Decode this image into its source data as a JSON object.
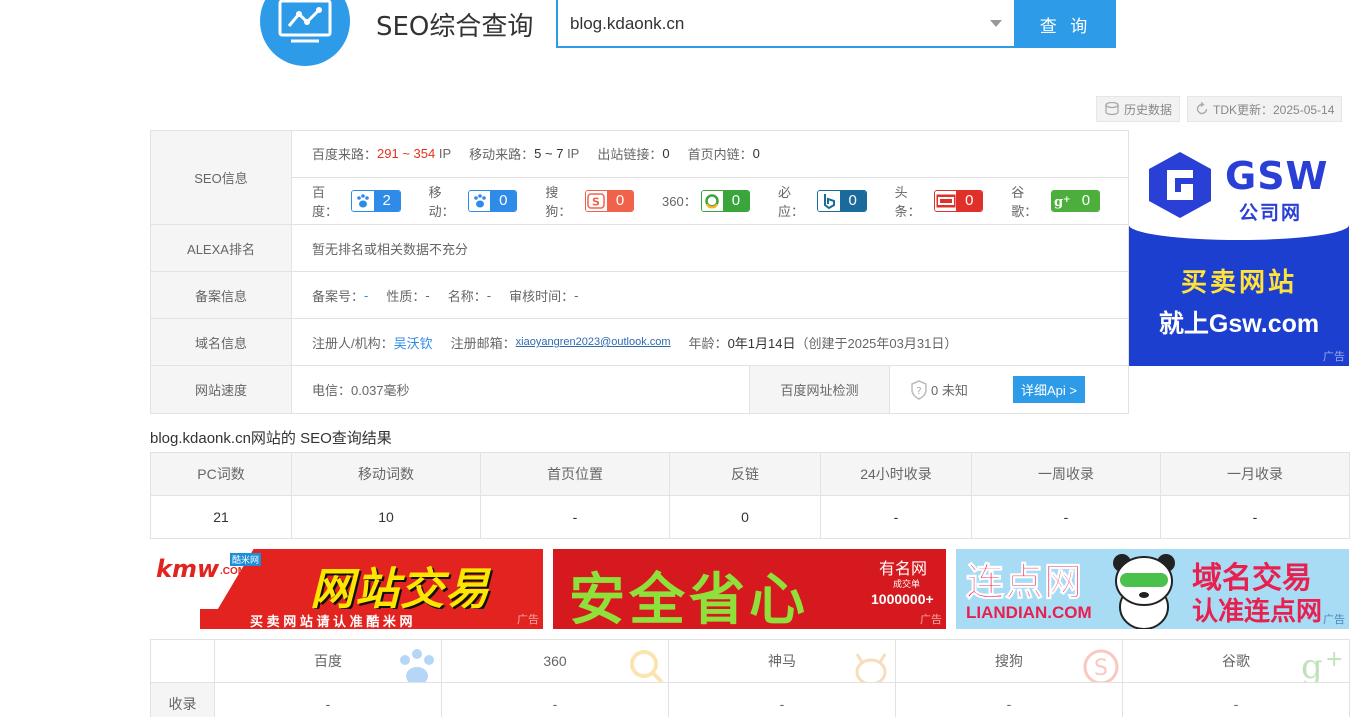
{
  "header": {
    "title": "SEO综合查询",
    "search_value": "blog.kdaonk.cn",
    "search_button": "查 询"
  },
  "toolbar": {
    "history": "历史数据",
    "tdk_update": "TDK更新：2025-05-14"
  },
  "seo_info": {
    "label": "SEO信息",
    "baidu_traffic_label": "百度来路：",
    "baidu_traffic_value": "291 ~ 354",
    "baidu_traffic_unit": "IP",
    "mobile_traffic_label": "移动来路：",
    "mobile_traffic_value": "5 ~ 7",
    "mobile_traffic_unit": "IP",
    "outlinks_label": "出站链接：",
    "outlinks_value": "0",
    "homepage_links_label": "首页内链：",
    "homepage_links_value": "0",
    "ranks": [
      {
        "label": "百度：",
        "icon": "baidu-paw-icon",
        "value": "2",
        "color": "#2e8be8"
      },
      {
        "label": "移动：",
        "icon": "baidu-mobile-paw-icon",
        "value": "0",
        "color": "#2e8be8"
      },
      {
        "label": "搜狗：",
        "icon": "sogou-icon",
        "value": "0",
        "color": "#f0634a"
      },
      {
        "label": "360：",
        "icon": "360-icon",
        "value": "0",
        "color": "#3aa53a"
      },
      {
        "label": "必应：",
        "icon": "bing-icon",
        "value": "0",
        "color": "#1a6b9c"
      },
      {
        "label": "头条：",
        "icon": "toutiao-icon",
        "value": "0",
        "color": "#e0302a"
      },
      {
        "label": "谷歌：",
        "icon": "google-plus-icon",
        "value": "0",
        "color": "#4caf3c"
      }
    ]
  },
  "alexa": {
    "label": "ALEXA排名",
    "value": "暂无排名或相关数据不充分"
  },
  "icp": {
    "label": "备案信息",
    "number_label": "备案号：",
    "number_value": "-",
    "nature_label": "性质：",
    "nature_value": "-",
    "name_label": "名称：",
    "name_value": "-",
    "audit_label": "审核时间：",
    "audit_value": "-"
  },
  "domain": {
    "label": "域名信息",
    "registrant_label": "注册人/机构：",
    "registrant_value": "吴沃钦",
    "email_label": "注册邮箱：",
    "email_value": "xiaoyangren2023@outlook.com",
    "age_label": "年龄：",
    "age_value": "0年1月14日",
    "created": "（创建于2025年03月31日）"
  },
  "speed": {
    "label": "网站速度",
    "telecom": "电信：0.037毫秒",
    "check_label": "百度网址检测",
    "check_value": "0 未知",
    "api_button": "详细Api >"
  },
  "ad_right": {
    "brand": "GSW",
    "brand_sub": "公司网",
    "line1": "买卖网站",
    "line2": "就上Gsw.com",
    "tag": "广告"
  },
  "result": {
    "title": "blog.kdaonk.cn网站的 SEO查询结果",
    "headers": [
      "PC词数",
      "移动词数",
      "首页位置",
      "反链",
      "24小时收录",
      "一周收录",
      "一月收录"
    ],
    "values": [
      "21",
      "10",
      "-",
      "0",
      "-",
      "-",
      "-"
    ]
  },
  "ads": {
    "kmw_logo": "kmw",
    "kmw_logo_tld": ".COM",
    "kmw_logo_cn": "酷米网",
    "kmw_main": "网站交易",
    "kmw_sub": "买 卖 网 站 请 认 准 酷 米 网",
    "ym_main": "安全省心",
    "ym_brand": "有名网",
    "ym_deal": "成交单",
    "ym_count": "1000000+",
    "ld_brand": "连点网",
    "ld_domain": "LIANDIAN.COM",
    "ld_line1": "域名交易",
    "ld_line2": "认准连点网",
    "tag": "广告"
  },
  "engines": {
    "headers": [
      "百度",
      "360",
      "神马",
      "搜狗",
      "谷歌"
    ],
    "row_label": "收录",
    "values": [
      "-",
      "-",
      "-",
      "-",
      "-"
    ]
  }
}
